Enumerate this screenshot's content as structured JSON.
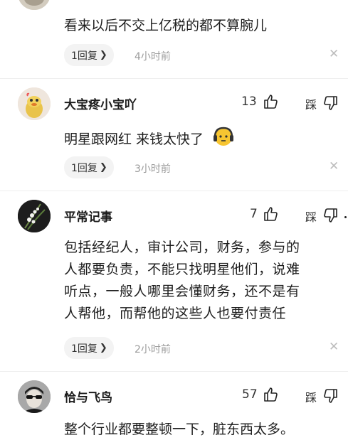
{
  "comments": [
    {
      "id": "c0",
      "username": "",
      "text_lines": [
        "看来以后不交上亿税的都不算腕儿"
      ],
      "reply_label": "1回复",
      "time": "4小时前",
      "avatar": "partial-avatar"
    },
    {
      "id": "c1",
      "username": "大宝疼小宝吖",
      "like_count": "13",
      "dislike_label": "踩",
      "text_lines": [
        "明星跟网红 来钱太快了"
      ],
      "emoji": "headphone-face-emoji",
      "reply_label": "1回复",
      "time": "3小时前",
      "avatar": "duck-avatar"
    },
    {
      "id": "c2",
      "username": "平常记事",
      "like_count": "7",
      "dislike_label": "踩",
      "text_lines": [
        "包括经纪人，审计公司，财务，参与的",
        "人都要负责，不能只找明星他们，说难",
        "听点，一般人哪里会懂财务，还不是有",
        "人帮他，而帮他的这些人也要付责任"
      ],
      "reply_label": "1回复",
      "time": "2小时前",
      "avatar": "flower-avatar"
    },
    {
      "id": "c3",
      "username": "恰与飞鸟",
      "like_count": "57",
      "dislike_label": "踩",
      "text_lines": [
        "整个行业都要整顿一下，脏东西太多。"
      ],
      "avatar": "sunglasses-avatar"
    }
  ],
  "colors": {
    "time_gray": "#9b9b9b",
    "pill_bg": "#f3f3f3",
    "close_gray": "#bdbdbd"
  },
  "icons": {
    "like": "thumbs-up-icon",
    "dislike": "thumbs-down-icon",
    "close": "close-icon",
    "chevron": "chevron-right-icon"
  }
}
